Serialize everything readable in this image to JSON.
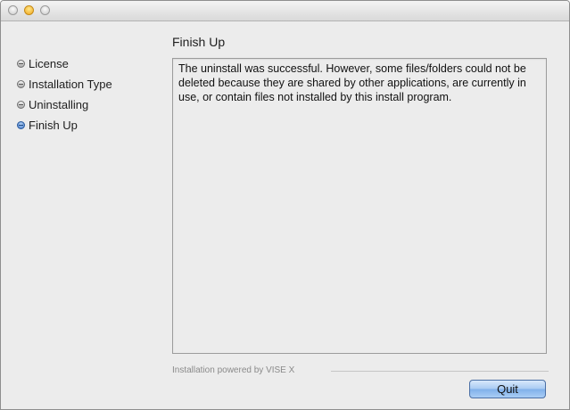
{
  "window": {
    "buttons": [
      "close",
      "minimize",
      "zoom"
    ]
  },
  "sidebar": {
    "steps": [
      {
        "label": "License",
        "active": false
      },
      {
        "label": "Installation Type",
        "active": false
      },
      {
        "label": "Uninstalling",
        "active": false
      },
      {
        "label": "Finish Up",
        "active": true
      }
    ]
  },
  "main": {
    "title": "Finish Up",
    "message": "The uninstall was successful. However, some files/folders could not be deleted because they are shared by other applications, are currently in use, or contain files not installed by this install program.",
    "footer": "Installation powered by VISE X",
    "quit_label": "Quit"
  },
  "colors": {
    "accent": "#7fb0ea",
    "active_bullet": "#3a74c9",
    "window_bg": "#ececec"
  }
}
